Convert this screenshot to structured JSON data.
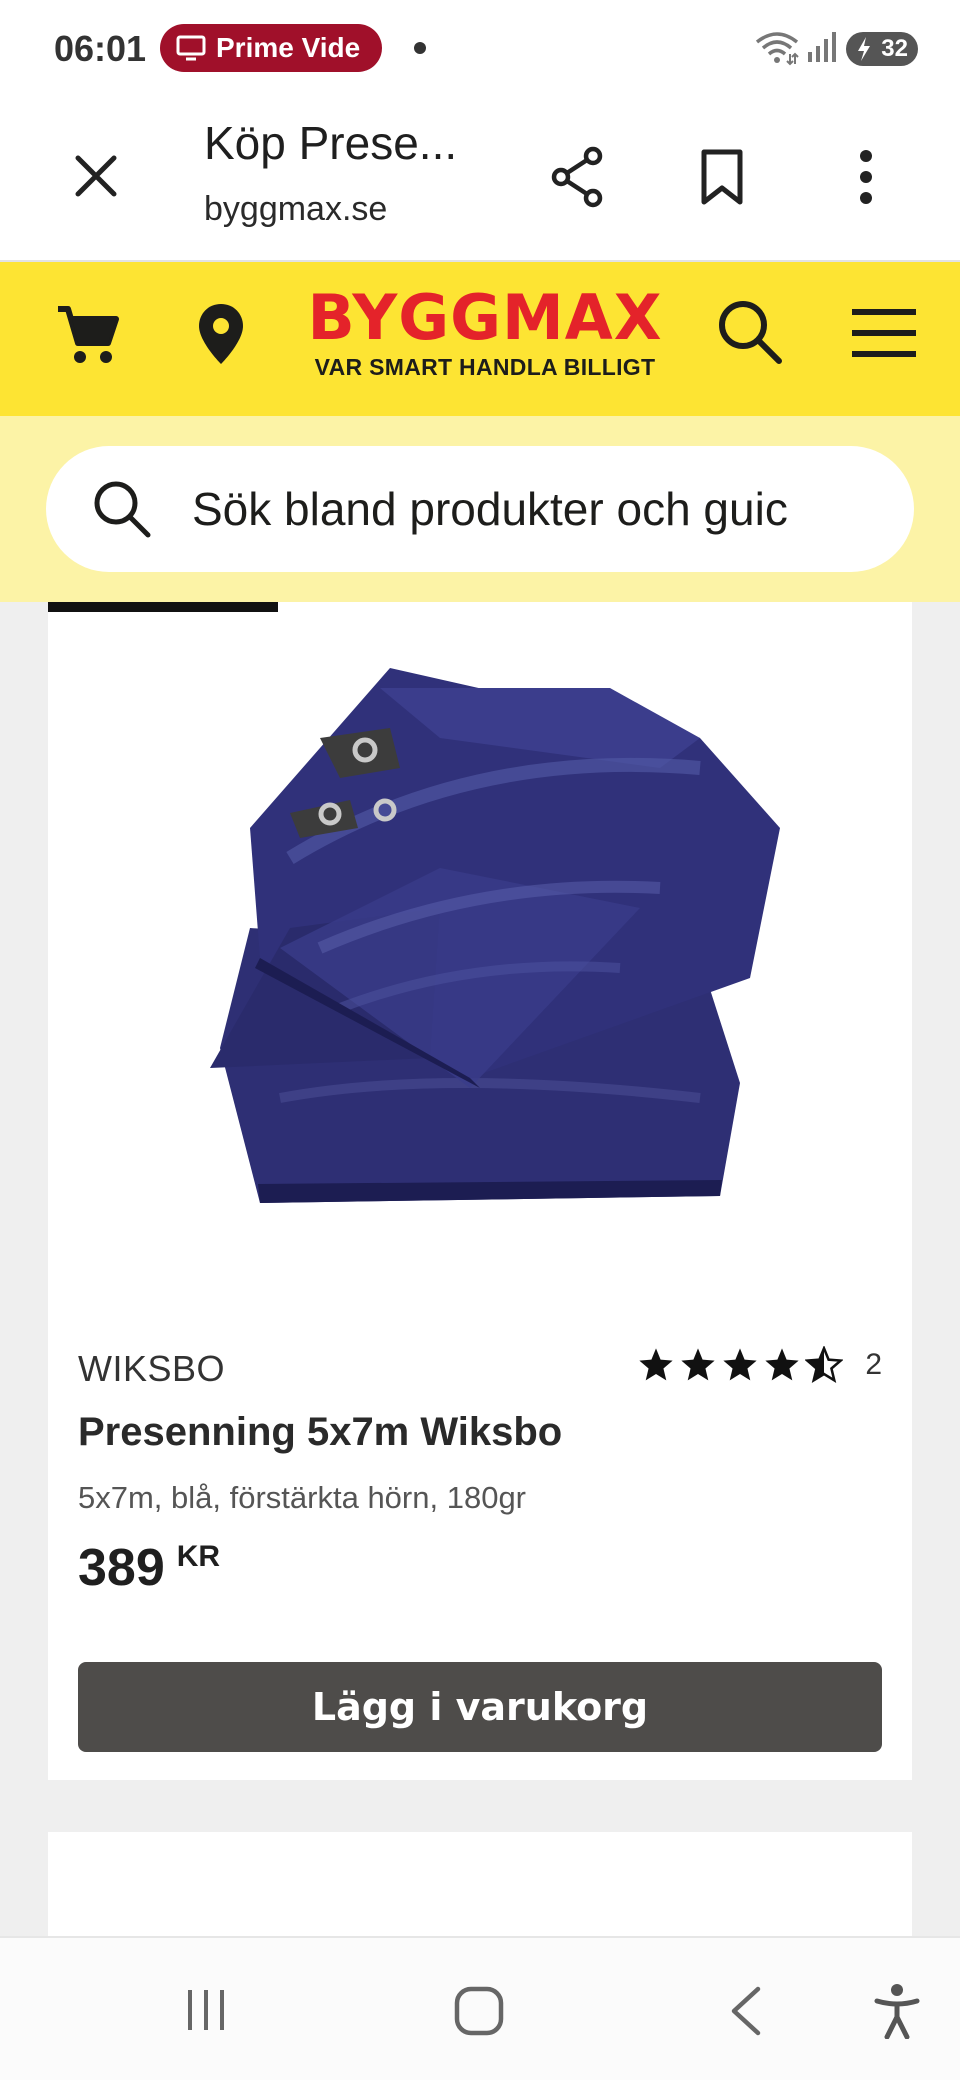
{
  "status_bar": {
    "time": "06:01",
    "notification_pill": "Prime Vide",
    "battery": "32",
    "icons": [
      "tv-icon",
      "wifi-icon",
      "signal-icon",
      "battery-icon"
    ]
  },
  "browser": {
    "page_title": "Köp Prese...",
    "domain": "byggmax.se",
    "icons": [
      "close-icon",
      "share-icon",
      "bookmark-icon",
      "more-icon"
    ]
  },
  "site_header": {
    "logo_text": "BYGGMAX",
    "tagline": "VAR SMART HANDLA BILLIGT",
    "icons": [
      "cart-icon",
      "location-pin-icon",
      "search-icon",
      "hamburger-menu-icon"
    ],
    "brand_color": "#fde433",
    "logo_color": "#e4232a"
  },
  "search": {
    "placeholder": "Sök bland produkter och guic"
  },
  "product": {
    "brand": "WIKSBO",
    "rating_value": 4.5,
    "rating_max": 5,
    "review_count": "2",
    "name": "Presenning 5x7m Wiksbo",
    "description": "5x7m, blå, förstärkta hörn, 180gr",
    "price": "389",
    "currency": "KR",
    "add_to_cart_label": "Lägg i varukorg",
    "image_icon": "blue-tarp-image"
  },
  "nav_bar": {
    "icons": [
      "recents-icon",
      "home-icon",
      "back-icon",
      "accessibility-icon"
    ]
  }
}
